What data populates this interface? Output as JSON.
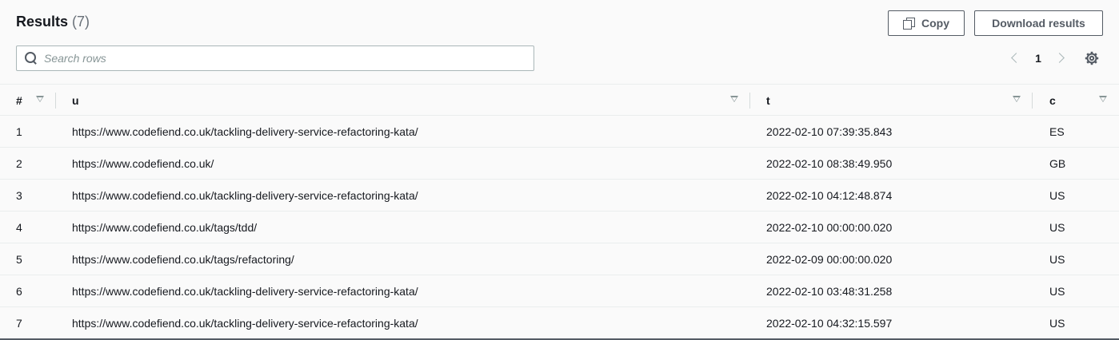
{
  "header": {
    "title": "Results",
    "count": "(7)"
  },
  "toolbar": {
    "copy_label": "Copy",
    "download_label": "Download results"
  },
  "search": {
    "placeholder": "Search rows",
    "value": ""
  },
  "pagination": {
    "current_page": "1"
  },
  "table": {
    "columns": [
      {
        "label": "#"
      },
      {
        "label": "u"
      },
      {
        "label": "t"
      },
      {
        "label": "c"
      }
    ],
    "rows": [
      {
        "idx": "1",
        "u": "https://www.codefiend.co.uk/tackling-delivery-service-refactoring-kata/",
        "t": "2022-02-10 07:39:35.843",
        "c": "ES"
      },
      {
        "idx": "2",
        "u": "https://www.codefiend.co.uk/",
        "t": "2022-02-10 08:38:49.950",
        "c": "GB"
      },
      {
        "idx": "3",
        "u": "https://www.codefiend.co.uk/tackling-delivery-service-refactoring-kata/",
        "t": "2022-02-10 04:12:48.874",
        "c": "US"
      },
      {
        "idx": "4",
        "u": "https://www.codefiend.co.uk/tags/tdd/",
        "t": "2022-02-10 00:00:00.020",
        "c": "US"
      },
      {
        "idx": "5",
        "u": "https://www.codefiend.co.uk/tags/refactoring/",
        "t": "2022-02-09 00:00:00.020",
        "c": "US"
      },
      {
        "idx": "6",
        "u": "https://www.codefiend.co.uk/tackling-delivery-service-refactoring-kata/",
        "t": "2022-02-10 03:48:31.258",
        "c": "US"
      },
      {
        "idx": "7",
        "u": "https://www.codefiend.co.uk/tackling-delivery-service-refactoring-kata/",
        "t": "2022-02-10 04:32:15.597",
        "c": "US"
      }
    ]
  },
  "icons": {
    "copy": "copy-icon",
    "search": "search-icon",
    "prev": "chevron-left-icon",
    "next": "chevron-right-icon",
    "settings": "gear-icon",
    "sort": "sort-descending-icon"
  },
  "colors": {
    "text": "#16191f",
    "muted": "#687078",
    "border": "#545b64",
    "background": "#fafafa"
  }
}
